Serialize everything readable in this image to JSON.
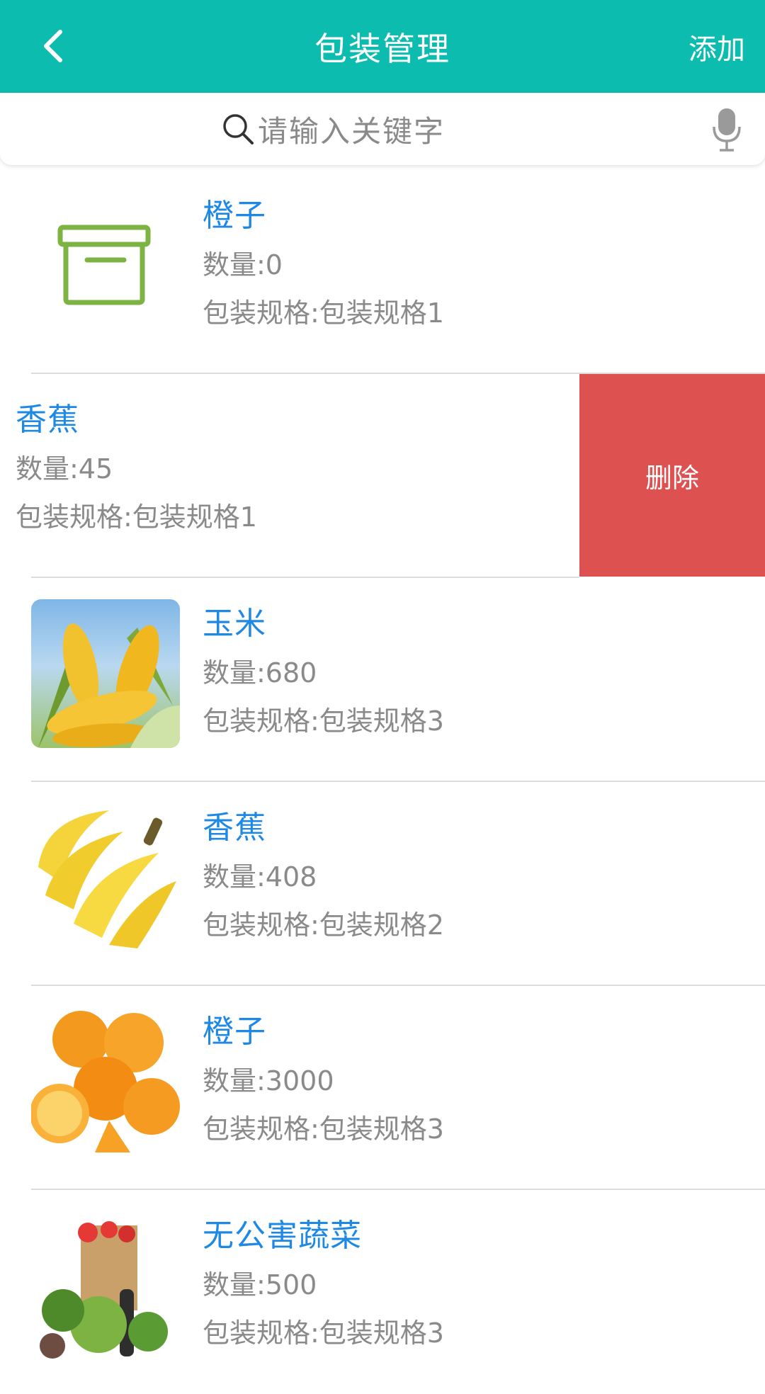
{
  "header": {
    "back_icon": "chevron-left-icon",
    "title": "包装管理",
    "add_label": "添加",
    "bg_color": "#0bbcaf"
  },
  "search": {
    "icon": "search-icon",
    "placeholder": "请输入关键字",
    "mic_icon": "microphone-icon"
  },
  "items": [
    {
      "name": "橙子",
      "qty": "数量:0",
      "spec": "包装规格:包装规格1",
      "image": "box-icon"
    },
    {
      "name": "香蕉",
      "qty": "数量:45",
      "spec": "包装规格:包装规格1",
      "image": "none",
      "swiped": true,
      "delete_label": "删除"
    },
    {
      "name": "玉米",
      "qty": "数量:680",
      "spec": "包装规格:包装规格3",
      "image": "corn-photo"
    },
    {
      "name": "香蕉",
      "qty": "数量:408",
      "spec": "包装规格:包装规格2",
      "image": "banana-photo"
    },
    {
      "name": "橙子",
      "qty": "数量:3000",
      "spec": "包装规格:包装规格3",
      "image": "orange-photo"
    },
    {
      "name": "无公害蔬菜",
      "qty": "数量:500",
      "spec": "包装规格:包装规格3",
      "image": "vegetables-photo"
    }
  ],
  "colors": {
    "name_text": "#1e88e5",
    "detail_text": "#8a8a8a",
    "delete_bg": "#dd5251",
    "divider": "#dcdcdc"
  }
}
